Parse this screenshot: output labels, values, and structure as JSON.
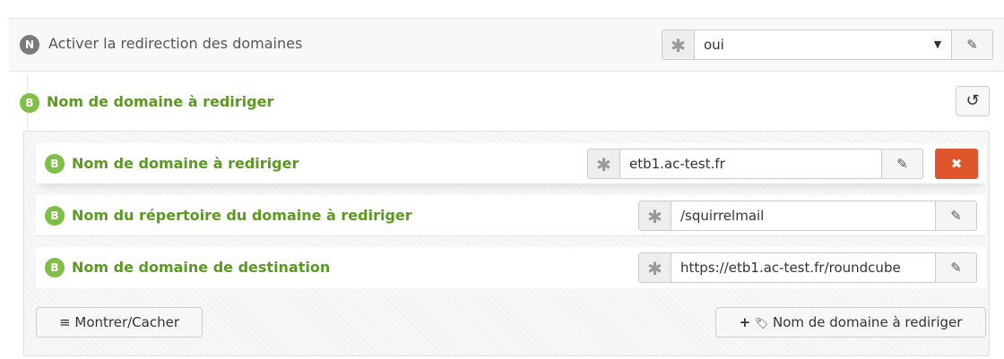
{
  "setting_redirect": {
    "badge": "N",
    "label": "Activer la redirection des domaines",
    "value": "oui"
  },
  "group": {
    "badge": "B",
    "label": "Nom de domaine à rediriger"
  },
  "rows": [
    {
      "badge": "B",
      "label": "Nom de domaine à rediriger",
      "value": "etb1.ac-test.fr"
    },
    {
      "badge": "B",
      "label": "Nom du répertoire du domaine à rediriger",
      "value": "/squirrelmail"
    },
    {
      "badge": "B",
      "label": "Nom de domaine de destination",
      "value": "https://etb1.ac-test.fr/roundcube"
    }
  ],
  "buttons": {
    "toggle": "Montrer/Cacher",
    "add": "Nom de domaine à rediriger"
  },
  "icons": {
    "required": "✱",
    "caret": "▼",
    "edit": "✎",
    "reset": "↺",
    "delete": "✖",
    "menu": "≡",
    "plus": "+",
    "tag": "🏷"
  }
}
